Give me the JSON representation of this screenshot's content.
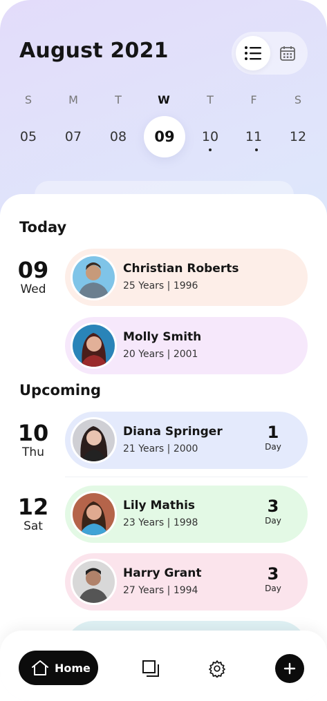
{
  "header": {
    "title": "August 2021"
  },
  "view_toggle": {
    "active": "list",
    "icons": [
      "list-icon",
      "calendar-icon"
    ]
  },
  "week": {
    "days": [
      "S",
      "M",
      "T",
      "W",
      "T",
      "F",
      "S"
    ],
    "dates": [
      "05",
      "07",
      "08",
      "09",
      "10",
      "11",
      "12"
    ],
    "selected_index": 3,
    "event_dot_indices": [
      4,
      5
    ]
  },
  "today": {
    "title": "Today",
    "date_num": "09",
    "weekday": "Wed",
    "people": [
      {
        "name": "Christian Roberts",
        "meta": "25 Years | 1996",
        "color": "#fdeee8"
      },
      {
        "name": "Molly Smith",
        "meta": "20 Years | 2001",
        "color": "#f6e8fb"
      }
    ]
  },
  "upcoming": {
    "title": "Upcoming",
    "groups": [
      {
        "date_num": "10",
        "weekday": "Thu",
        "people": [
          {
            "name": "Diana Springer",
            "meta": "21 Years | 2000",
            "days": "1",
            "unit": "Day",
            "color": "#e4eafc"
          }
        ]
      },
      {
        "date_num": "12",
        "weekday": "Sat",
        "people": [
          {
            "name": "Lily Mathis",
            "meta": "23 Years | 1998",
            "days": "3",
            "unit": "Day",
            "color": "#e3f9e5"
          },
          {
            "name": "Harry Grant",
            "meta": "27 Years | 1994",
            "days": "3",
            "unit": "Day",
            "color": "#fbe4ec"
          }
        ]
      }
    ]
  },
  "bottom_nav": {
    "home_label": "Home"
  }
}
